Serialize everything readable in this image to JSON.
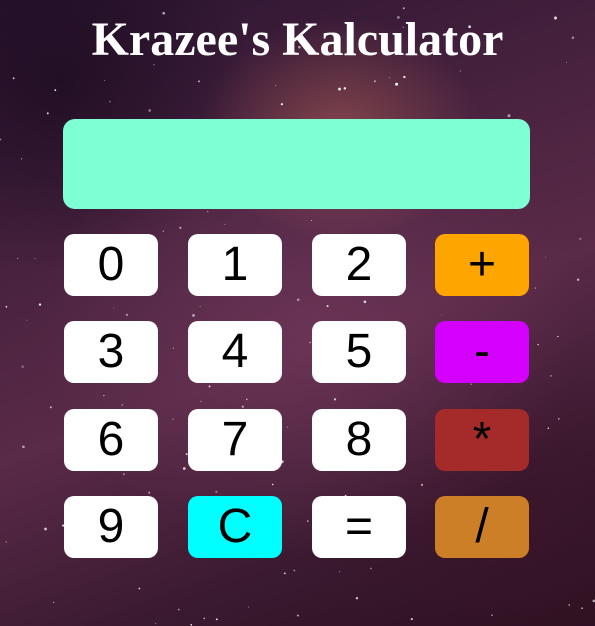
{
  "title": "Krazee's Kalculator",
  "display": {
    "value": ""
  },
  "keys": [
    {
      "label": "0",
      "name": "key-0"
    },
    {
      "label": "1",
      "name": "key-1"
    },
    {
      "label": "2",
      "name": "key-2"
    },
    {
      "label": "+",
      "name": "plus-button"
    },
    {
      "label": "3",
      "name": "key-3"
    },
    {
      "label": "4",
      "name": "key-4"
    },
    {
      "label": "5",
      "name": "key-5"
    },
    {
      "label": "-",
      "name": "minus-button"
    },
    {
      "label": "6",
      "name": "key-6"
    },
    {
      "label": "7",
      "name": "key-7"
    },
    {
      "label": "8",
      "name": "key-8"
    },
    {
      "label": "*",
      "name": "multiply-button"
    },
    {
      "label": "9",
      "name": "key-9"
    },
    {
      "label": "C",
      "name": "clear-button"
    },
    {
      "label": "=",
      "name": "equals-button"
    },
    {
      "label": "/",
      "name": "divide-button"
    }
  ],
  "colors": {
    "display": "#7fffd4",
    "digit": "#ffffff",
    "plus": "#ffa500",
    "minus": "#d400ff",
    "multiply": "#a52a2a",
    "divide": "#cd7f27",
    "clear": "#00ffff",
    "title": "#ffffff"
  },
  "background": "starry-night-sky"
}
